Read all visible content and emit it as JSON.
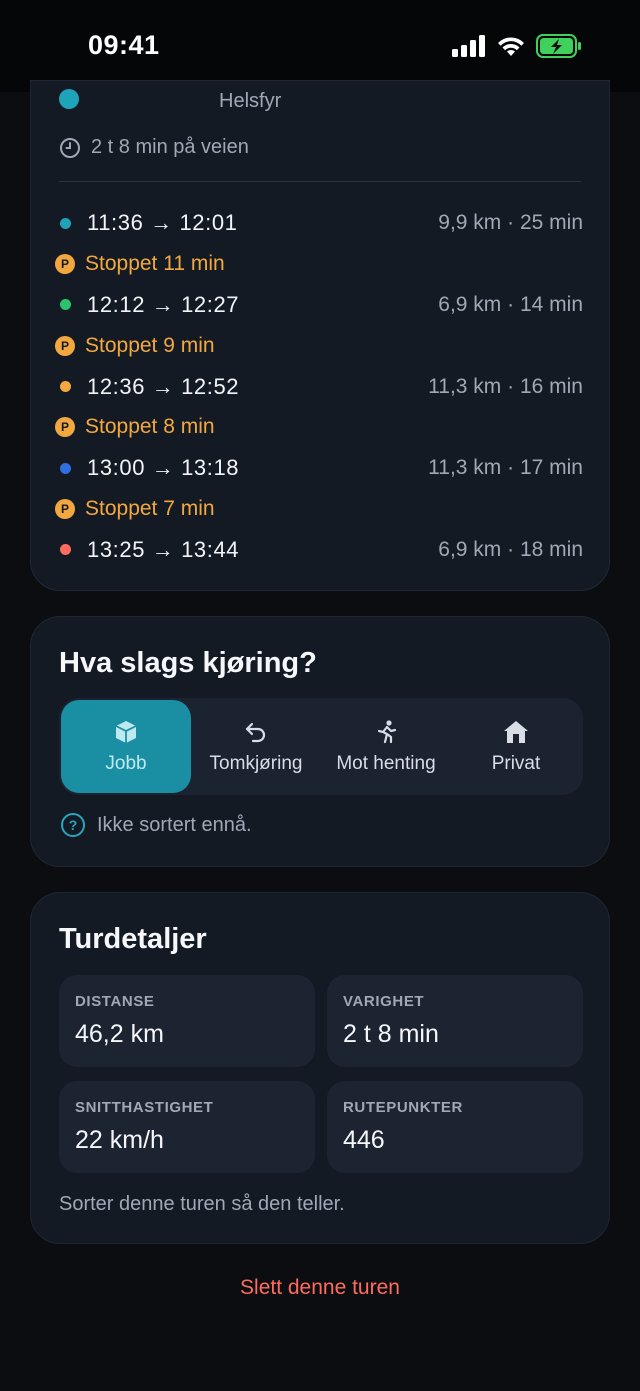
{
  "status_bar": {
    "time": "09:41"
  },
  "trip": {
    "origin_label": "Helsfyr",
    "duration_text": "2 t 8 min på veien",
    "rows": [
      {
        "kind": "segment",
        "time": "11:36 → 12:01",
        "meta": "9,9 km · 25 min",
        "color": "#1ea3b8"
      },
      {
        "kind": "stop",
        "text": "Stoppet 11 min"
      },
      {
        "kind": "segment",
        "time": "12:12 → 12:27",
        "meta": "6,9 km · 14 min",
        "color": "#2bc46c"
      },
      {
        "kind": "stop",
        "text": "Stoppet 9 min"
      },
      {
        "kind": "segment",
        "time": "12:36 → 12:52",
        "meta": "11,3 km · 16 min",
        "color": "#f3a83f"
      },
      {
        "kind": "stop",
        "text": "Stoppet 8 min"
      },
      {
        "kind": "segment",
        "time": "13:00 → 13:18",
        "meta": "11,3 km · 17 min",
        "color": "#2f6fe0"
      },
      {
        "kind": "stop",
        "text": "Stoppet 7 min"
      },
      {
        "kind": "segment",
        "time": "13:25 → 13:44",
        "meta": "6,9 km · 18 min",
        "color": "#ff6b5e"
      }
    ],
    "stop_badge_letter": "P"
  },
  "trip_type": {
    "title": "Hva slags kjøring?",
    "options": [
      {
        "label": "Jobb",
        "icon": "box-icon",
        "selected": true
      },
      {
        "label": "Tomkjøring",
        "icon": "return-arrow-icon",
        "selected": false
      },
      {
        "label": "Mot henting",
        "icon": "running-person-icon",
        "selected": false
      },
      {
        "label": "Privat",
        "icon": "house-icon",
        "selected": false
      }
    ],
    "hint": "Ikke sortert ennå."
  },
  "details": {
    "title": "Turdetaljer",
    "tiles": [
      {
        "label": "DISTANSE",
        "value": "46,2 km"
      },
      {
        "label": "VARIGHET",
        "value": "2 t 8 min"
      },
      {
        "label": "SNITTHASTIGHET",
        "value": "22 km/h"
      },
      {
        "label": "RUTEPUNKTER",
        "value": "446"
      }
    ],
    "note": "Sorter denne turen så den teller."
  },
  "delete_label": "Slett denne turen",
  "colors": {
    "accent": "#1a8fa3",
    "stop": "#f3a83f",
    "danger": "#ff6b5e",
    "card": "#141a24"
  }
}
